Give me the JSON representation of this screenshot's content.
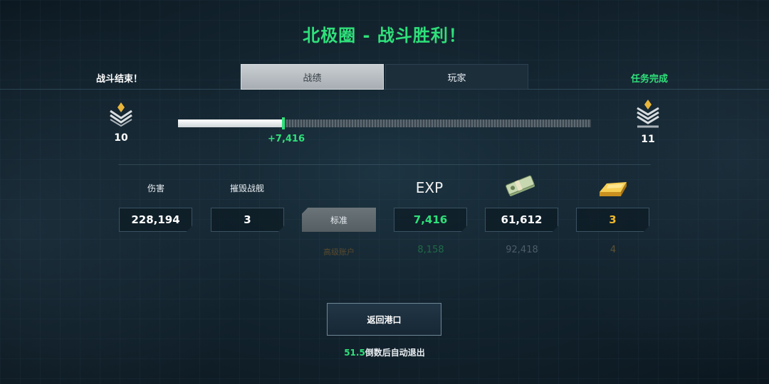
{
  "title": "北极圈 - 战斗胜利！",
  "left_status": "战斗结束！",
  "right_status": "任务完成",
  "tabs": [
    {
      "label": "战绩",
      "active": true
    },
    {
      "label": "玩家",
      "active": false
    }
  ],
  "rank_current": "10",
  "rank_next": "11",
  "exp_progress_fraction": 0.255,
  "exp_gain": "+7,416",
  "stats": {
    "damage_label": "伤害",
    "damage_value": "228,194",
    "ships_label": "摧毁战舰",
    "ships_value": "3"
  },
  "rewards": {
    "exp_header": "EXP",
    "money_icon": "cash-stack-icon",
    "gold_icon": "gold-bar-icon",
    "standard_label": "标准",
    "standard_exp": "7,416",
    "standard_money": "61,612",
    "standard_gold": "3",
    "premium_label": "高级账户",
    "premium_exp": "8,158",
    "premium_money": "92,418",
    "premium_gold": "4"
  },
  "return_button": "返回港口",
  "countdown_seconds": "51.5",
  "countdown_text": "倒数后自动退出",
  "colors": {
    "accent_green": "#2fe07a",
    "gold": "#f0b92a"
  }
}
